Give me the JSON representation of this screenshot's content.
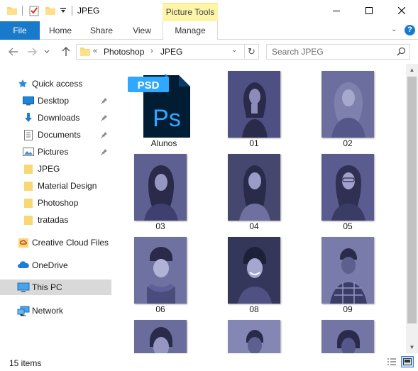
{
  "window": {
    "title": "JPEG",
    "context_group": "Picture Tools"
  },
  "ribbon": {
    "tabs": [
      {
        "label": "File"
      },
      {
        "label": "Home"
      },
      {
        "label": "Share"
      },
      {
        "label": "View"
      },
      {
        "label": "Manage"
      }
    ]
  },
  "address": {
    "overflow": "«",
    "crumbs": [
      "Photoshop",
      "JPEG"
    ],
    "separator": "›"
  },
  "search": {
    "placeholder": "Search JPEG"
  },
  "nav": {
    "quick_access": "Quick access",
    "pinned": [
      {
        "label": "Desktop"
      },
      {
        "label": "Downloads"
      },
      {
        "label": "Documents"
      },
      {
        "label": "Pictures"
      }
    ],
    "folders": [
      {
        "label": "JPEG"
      },
      {
        "label": "Material Design"
      },
      {
        "label": "Photoshop"
      },
      {
        "label": "tratadas"
      }
    ],
    "creative_cloud": "Creative Cloud Files",
    "onedrive": "OneDrive",
    "this_pc": "This PC",
    "network": "Network"
  },
  "files": [
    {
      "name": "Alunos",
      "type": "psd",
      "badge": "PSD",
      "glyph": "Ps"
    },
    {
      "name": "01",
      "type": "jpeg"
    },
    {
      "name": "02",
      "type": "jpeg"
    },
    {
      "name": "03",
      "type": "jpeg"
    },
    {
      "name": "04",
      "type": "jpeg"
    },
    {
      "name": "05",
      "type": "jpeg"
    },
    {
      "name": "06",
      "type": "jpeg"
    },
    {
      "name": "08",
      "type": "jpeg"
    },
    {
      "name": "09",
      "type": "jpeg"
    }
  ],
  "status": {
    "item_count": "15 items"
  },
  "colors": {
    "accent": "#1979ca",
    "picture_tools": "#fcf5a8",
    "thumb_tint": "#5a5c8f",
    "psd_dark": "#001d34",
    "psd_blue": "#31a8ff"
  }
}
